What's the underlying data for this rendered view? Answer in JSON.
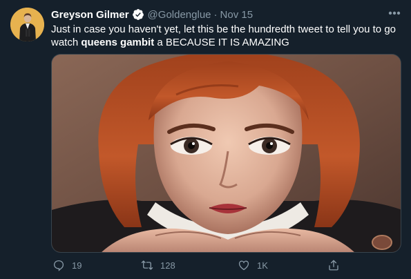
{
  "tweet": {
    "author": "Greyson Gilmer",
    "handle": "@Goldenglue",
    "separator": "·",
    "date": "Nov 15",
    "text_part1": "Just in case you haven't yet, let this be the hundredth tweet to tell you to go watch ",
    "text_bold": "queens gambit",
    "text_part2": " a BECAUSE IT IS AMAZING"
  },
  "actions": {
    "reply_count": "19",
    "retweet_count": "128",
    "like_count": "1K"
  },
  "colors": {
    "background": "#15202b",
    "muted_text": "#8899a6",
    "verified_blue": "#1da1f2"
  },
  "icons": [
    "verified-badge-icon",
    "more-options-icon",
    "reply-icon",
    "retweet-icon",
    "like-icon",
    "share-icon"
  ]
}
